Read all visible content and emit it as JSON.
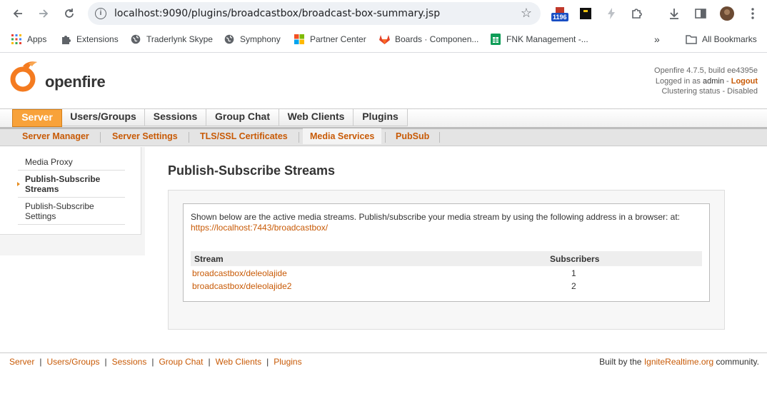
{
  "browser": {
    "url": "localhost:9090/plugins/broadcastbox/broadcast-box-summary.jsp",
    "extension_badge": "1196",
    "bookmarks": [
      {
        "label": "Apps",
        "icon": "apps-grid-icon"
      },
      {
        "label": "Extensions",
        "icon": "puzzle-icon"
      },
      {
        "label": "Traderlynk Skype",
        "icon": "globe-icon"
      },
      {
        "label": "Symphony",
        "icon": "globe-icon"
      },
      {
        "label": "Partner Center",
        "icon": "microsoft-icon"
      },
      {
        "label": "Boards · Componen...",
        "icon": "gitlab-icon"
      },
      {
        "label": "FNK Management -...",
        "icon": "sheets-icon"
      }
    ],
    "more_bookmarks": "»",
    "all_bookmarks": "All Bookmarks"
  },
  "header": {
    "logo_text": "openfire",
    "version": "Openfire 4.7.5, build ee4395e",
    "logged_in_prefix": "Logged in as ",
    "user": "admin",
    "logout_sep": " - ",
    "logout": "Logout",
    "clustering": "Clustering status - Disabled"
  },
  "tabs": [
    "Server",
    "Users/Groups",
    "Sessions",
    "Group Chat",
    "Web Clients",
    "Plugins"
  ],
  "subtabs": [
    "Server Manager",
    "Server Settings",
    "TLS/SSL Certificates",
    "Media Services",
    "PubSub"
  ],
  "sidebar": {
    "items": [
      {
        "label": "Media Proxy"
      },
      {
        "label": "Publish-Subscribe Streams"
      },
      {
        "label": "Publish-Subscribe Settings"
      }
    ]
  },
  "main": {
    "title": "Publish-Subscribe Streams",
    "description": "Shown below are the active media streams. Publish/subscribe your media stream by using the following address in a browser: at:",
    "address_link": "https://localhost:7443/broadcastbox/",
    "columns": [
      "Stream",
      "Subscribers"
    ],
    "rows": [
      {
        "stream": "broadcastbox/deleolajide",
        "subscribers": "1"
      },
      {
        "stream": "broadcastbox/deleolajide2",
        "subscribers": "2"
      }
    ]
  },
  "footer": {
    "links": [
      "Server",
      "Users/Groups",
      "Sessions",
      "Group Chat",
      "Web Clients",
      "Plugins"
    ],
    "credit_prefix": "Built by the ",
    "credit_link": "IgniteRealtime.org",
    "credit_suffix": " community."
  },
  "colors": {
    "accent": "#c85a06",
    "tab_active": "#f8a23a"
  }
}
